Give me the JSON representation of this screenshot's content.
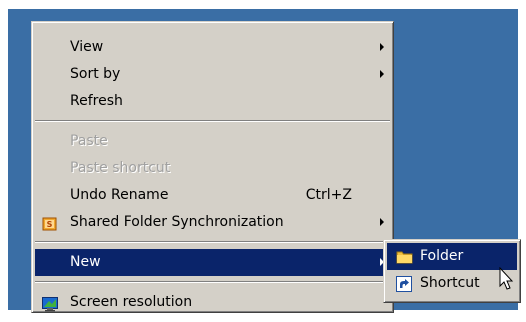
{
  "context_menu": {
    "items": {
      "view": {
        "label": "View"
      },
      "sort_by": {
        "label": "Sort by"
      },
      "refresh": {
        "label": "Refresh"
      },
      "paste": {
        "label": "Paste"
      },
      "paste_shortcut": {
        "label": "Paste shortcut"
      },
      "undo_rename": {
        "label": "Undo Rename",
        "shortcut": "Ctrl+Z"
      },
      "shared_folder_sync": {
        "label": "Shared Folder Synchronization",
        "icon": "shared-folder-sync-icon"
      },
      "new": {
        "label": "New"
      },
      "screen_resolution": {
        "label": "Screen resolution",
        "icon": "screen-resolution-icon"
      }
    }
  },
  "new_submenu": {
    "items": {
      "folder": {
        "label": "Folder",
        "icon": "folder-icon"
      },
      "shortcut": {
        "label": "Shortcut",
        "icon": "shortcut-icon"
      }
    }
  },
  "colors": {
    "desktop": "#3a6ea5",
    "menu_face": "#d4d0c8",
    "highlight": "#0a246a"
  }
}
